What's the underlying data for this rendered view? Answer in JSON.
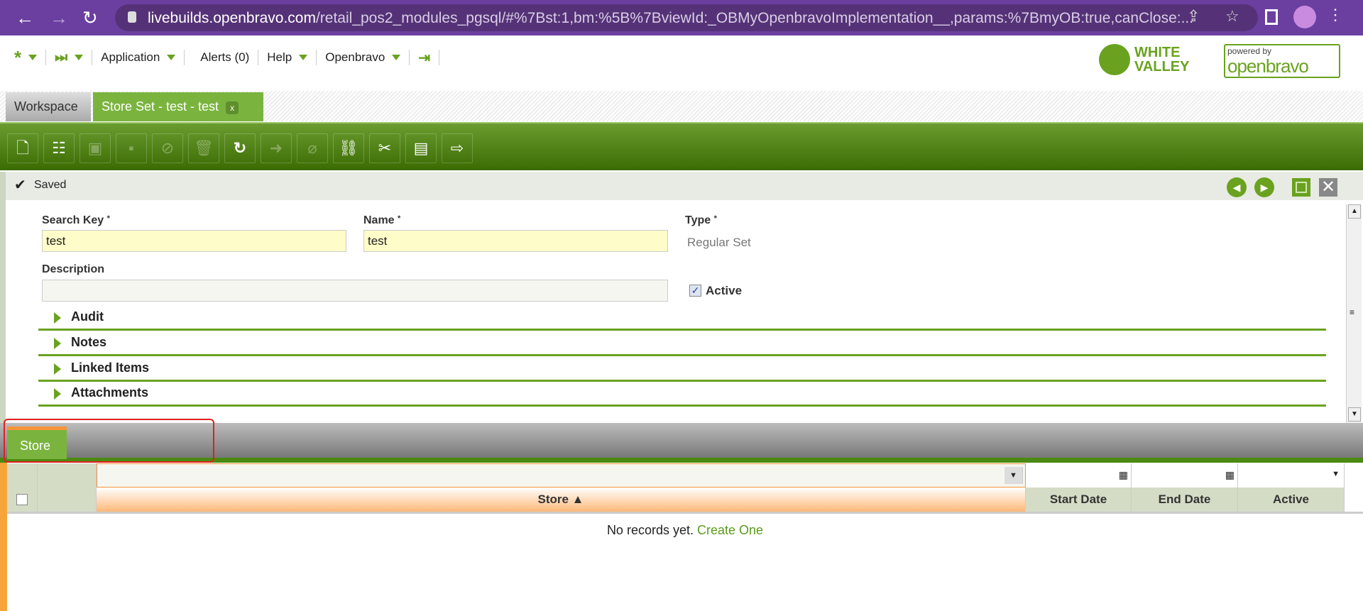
{
  "browser": {
    "url_host": "livebuilds.openbravo.com",
    "url_path": "/retail_pos2_modules_pgsql/#%7Bst:1,bm:%5B%7BviewId:_OBMyOpenbravoImplementation__,params:%7BmyOB:true,canClose:..."
  },
  "menu": {
    "application": "Application",
    "alerts": "Alerts (0)",
    "help": "Help",
    "openbravo": "Openbravo"
  },
  "logos": {
    "white_valley": "WHITE VALLEY",
    "powered_by": "powered by",
    "openbravo": "openbravo"
  },
  "tabs": [
    {
      "label": "Workspace"
    },
    {
      "label": "Store Set - test - test",
      "close": "x"
    }
  ],
  "status": {
    "text": "Saved"
  },
  "form": {
    "search_key": {
      "label": "Search Key",
      "value": "test"
    },
    "name": {
      "label": "Name",
      "value": "test"
    },
    "type": {
      "label": "Type",
      "value": "Regular Set"
    },
    "description": {
      "label": "Description",
      "value": ""
    },
    "active": {
      "label": "Active",
      "checked": true
    },
    "required_mark": "*",
    "sections": [
      "Audit",
      "Notes",
      "Linked Items",
      "Attachments"
    ]
  },
  "subtab": {
    "label": "Store"
  },
  "grid": {
    "columns": [
      "Store ▲",
      "Start Date",
      "End Date",
      "Active"
    ],
    "empty": "No records yet.",
    "create": "Create One"
  },
  "colors": {
    "green": "#6aa21f",
    "orange": "#f7943a",
    "purple": "#6b3fa0"
  }
}
